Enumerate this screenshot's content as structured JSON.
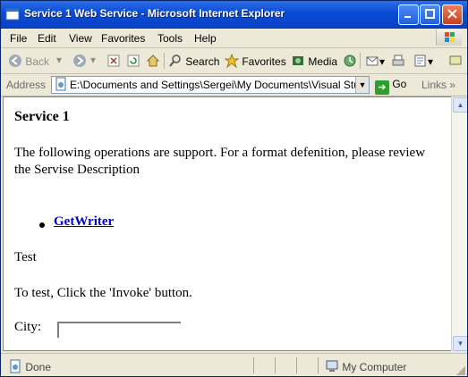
{
  "window": {
    "title": "Service 1 Web Service - Microsoft Internet Explorer",
    "minimize_icon": "minimize-icon",
    "maximize_icon": "maximize-icon",
    "close_icon": "close-icon"
  },
  "menubar": {
    "items": [
      "File",
      "Edit",
      "View",
      "Favorites",
      "Tools",
      "Help"
    ]
  },
  "toolbar": {
    "back_label": "Back",
    "search_label": "Search",
    "favorites_label": "Favorites",
    "media_label": "Media"
  },
  "address": {
    "label": "Address",
    "value": "E:\\Documents and Settings\\Sergei\\My Documents\\Visual Stu",
    "go_label": "Go",
    "links_label": "Links"
  },
  "content": {
    "title": "Service 1",
    "description": "The following operations are support. For a format defenition, please review the Servise Description",
    "operations": [
      "GetWriter"
    ],
    "test_heading": "Test",
    "instructions": "To test, Click the 'Invoke' button.",
    "city_label": "City:",
    "city_value": ""
  },
  "status": {
    "text": "Done",
    "zone": "My Computer"
  },
  "colors": {
    "titlebar": "#0a4bd6",
    "link": "#0000cc",
    "chrome": "#ece9d8"
  }
}
